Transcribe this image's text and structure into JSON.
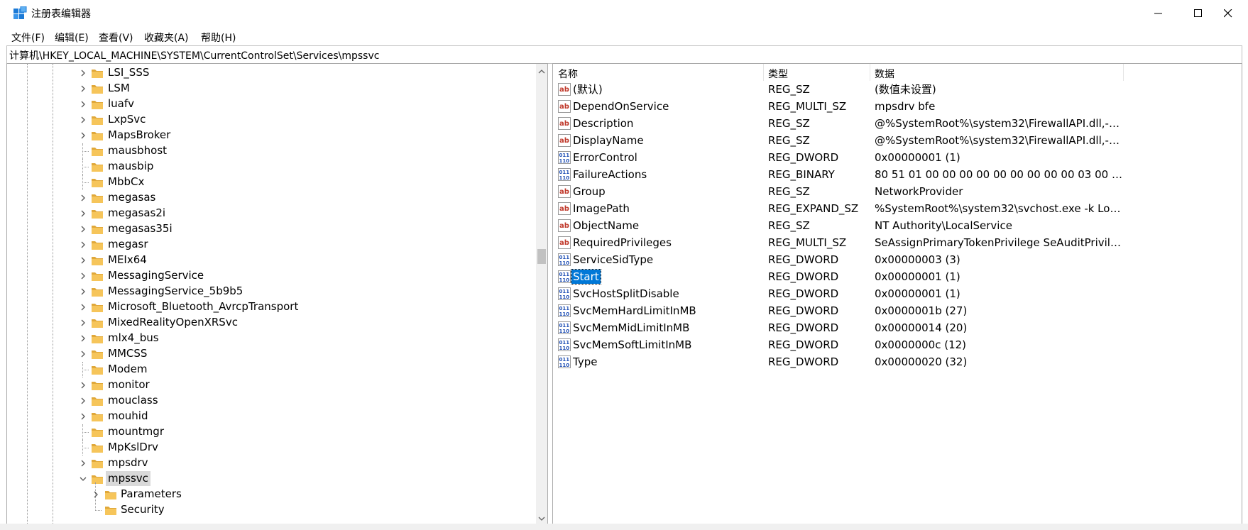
{
  "window": {
    "title": "注册表编辑器",
    "minimize_label": "minimize",
    "maximize_label": "maximize",
    "close_label": "close"
  },
  "menu": [
    {
      "label": "文件(F)"
    },
    {
      "label": "编辑(E)"
    },
    {
      "label": "查看(V)"
    },
    {
      "label": "收藏夹(A)"
    },
    {
      "label": "帮助(H)"
    }
  ],
  "address": {
    "path": "计算机\\HKEY_LOCAL_MACHINE\\SYSTEM\\CurrentControlSet\\Services\\mpssvc"
  },
  "tree": {
    "items": [
      {
        "label": "LSI_SSS",
        "expandable": true
      },
      {
        "label": "LSM",
        "expandable": true
      },
      {
        "label": "luafv",
        "expandable": true
      },
      {
        "label": "LxpSvc",
        "expandable": true
      },
      {
        "label": "MapsBroker",
        "expandable": true
      },
      {
        "label": "mausbhost",
        "expandable": false
      },
      {
        "label": "mausbip",
        "expandable": false
      },
      {
        "label": "MbbCx",
        "expandable": false
      },
      {
        "label": "megasas",
        "expandable": true
      },
      {
        "label": "megasas2i",
        "expandable": true
      },
      {
        "label": "megasas35i",
        "expandable": true
      },
      {
        "label": "megasr",
        "expandable": true
      },
      {
        "label": "MEIx64",
        "expandable": true
      },
      {
        "label": "MessagingService",
        "expandable": true
      },
      {
        "label": "MessagingService_5b9b5",
        "expandable": true
      },
      {
        "label": "Microsoft_Bluetooth_AvrcpTransport",
        "expandable": true
      },
      {
        "label": "MixedRealityOpenXRSvc",
        "expandable": true
      },
      {
        "label": "mlx4_bus",
        "expandable": true
      },
      {
        "label": "MMCSS",
        "expandable": true
      },
      {
        "label": "Modem",
        "expandable": false
      },
      {
        "label": "monitor",
        "expandable": true
      },
      {
        "label": "mouclass",
        "expandable": true
      },
      {
        "label": "mouhid",
        "expandable": true
      },
      {
        "label": "mountmgr",
        "expandable": false
      },
      {
        "label": "MpKslDrv",
        "expandable": false
      },
      {
        "label": "mpsdrv",
        "expandable": true
      },
      {
        "label": "mpssvc",
        "expanded": true,
        "selected": true
      }
    ],
    "children": [
      {
        "label": "Parameters",
        "expandable": true
      },
      {
        "label": "Security",
        "expandable": false
      }
    ]
  },
  "list": {
    "headers": {
      "name": "名称",
      "type": "类型",
      "data": "数据"
    },
    "rows": [
      {
        "icon": "string-value-icon",
        "name": "(默认)",
        "type": "REG_SZ",
        "data": "(数值未设置)"
      },
      {
        "icon": "string-value-icon",
        "name": "DependOnService",
        "type": "REG_MULTI_SZ",
        "data": "mpsdrv bfe"
      },
      {
        "icon": "string-value-icon",
        "name": "Description",
        "type": "REG_SZ",
        "data": "@%SystemRoot%\\system32\\FirewallAPI.dll,-2..."
      },
      {
        "icon": "string-value-icon",
        "name": "DisplayName",
        "type": "REG_SZ",
        "data": "@%SystemRoot%\\system32\\FirewallAPI.dll,-2..."
      },
      {
        "icon": "binary-value-icon",
        "name": "ErrorControl",
        "type": "REG_DWORD",
        "data": "0x00000001 (1)"
      },
      {
        "icon": "binary-value-icon",
        "name": "FailureActions",
        "type": "REG_BINARY",
        "data": "80 51 01 00 00 00 00 00 00 00 00 00 03 00 00 ..."
      },
      {
        "icon": "string-value-icon",
        "name": "Group",
        "type": "REG_SZ",
        "data": "NetworkProvider"
      },
      {
        "icon": "string-value-icon",
        "name": "ImagePath",
        "type": "REG_EXPAND_SZ",
        "data": "%SystemRoot%\\system32\\svchost.exe -k Loc..."
      },
      {
        "icon": "string-value-icon",
        "name": "ObjectName",
        "type": "REG_SZ",
        "data": "NT Authority\\LocalService"
      },
      {
        "icon": "string-value-icon",
        "name": "RequiredPrivileges",
        "type": "REG_MULTI_SZ",
        "data": "SeAssignPrimaryTokenPrivilege SeAuditPrivile..."
      },
      {
        "icon": "binary-value-icon",
        "name": "ServiceSidType",
        "type": "REG_DWORD",
        "data": "0x00000003 (3)"
      },
      {
        "icon": "binary-value-icon",
        "name": "Start",
        "type": "REG_DWORD",
        "data": "0x00000001 (1)",
        "selected": true
      },
      {
        "icon": "binary-value-icon",
        "name": "SvcHostSplitDisable",
        "type": "REG_DWORD",
        "data": "0x00000001 (1)"
      },
      {
        "icon": "binary-value-icon",
        "name": "SvcMemHardLimitInMB",
        "type": "REG_DWORD",
        "data": "0x0000001b (27)"
      },
      {
        "icon": "binary-value-icon",
        "name": "SvcMemMidLimitInMB",
        "type": "REG_DWORD",
        "data": "0x00000014 (20)"
      },
      {
        "icon": "binary-value-icon",
        "name": "SvcMemSoftLimitInMB",
        "type": "REG_DWORD",
        "data": "0x0000000c (12)"
      },
      {
        "icon": "binary-value-icon",
        "name": "Type",
        "type": "REG_DWORD",
        "data": "0x00000020 (32)"
      }
    ]
  },
  "colors": {
    "selection_blue": "#0078d7",
    "tree_selection": "#d9d9d9",
    "folder_yellow": "#f6c55a",
    "folder_dark": "#e0a83a"
  }
}
